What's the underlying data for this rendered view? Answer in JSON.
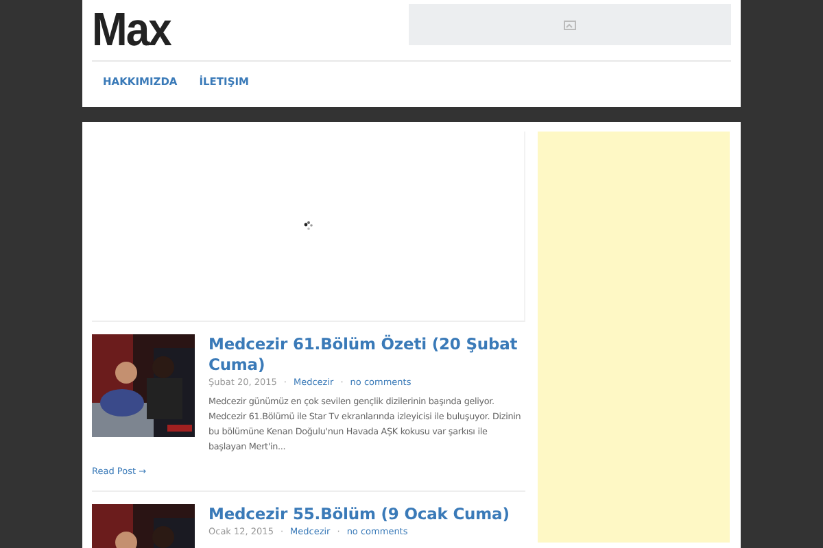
{
  "logo": "Max",
  "meta_separator": "·",
  "nav": [
    {
      "label": "HAKKIMIZDA"
    },
    {
      "label": "İLETIŞIM"
    }
  ],
  "posts": [
    {
      "title": "Medcezir 61.Bölüm Özeti (20 Şubat Cuma)",
      "date": "Şubat 20, 2015",
      "category": "Medcezir",
      "comments": "no comments",
      "excerpt": "Medcezir günümüz en çok sevilen gençlik dizilerinin başında geliyor. Medcezir 61.Bölümü ile Star Tv ekranlarında izleyicisi ile buluşuyor. Dizinin bu bölümüne Kenan Doğulu'nun Havada AŞK kokusu var şarkısı ile başlayan Mert'in...",
      "more": "Read Post →"
    },
    {
      "title": "Medcezir 55.Bölüm (9 Ocak Cuma)",
      "date": "Ocak 12, 2015",
      "category": "Medcezir",
      "comments": "no comments"
    }
  ]
}
